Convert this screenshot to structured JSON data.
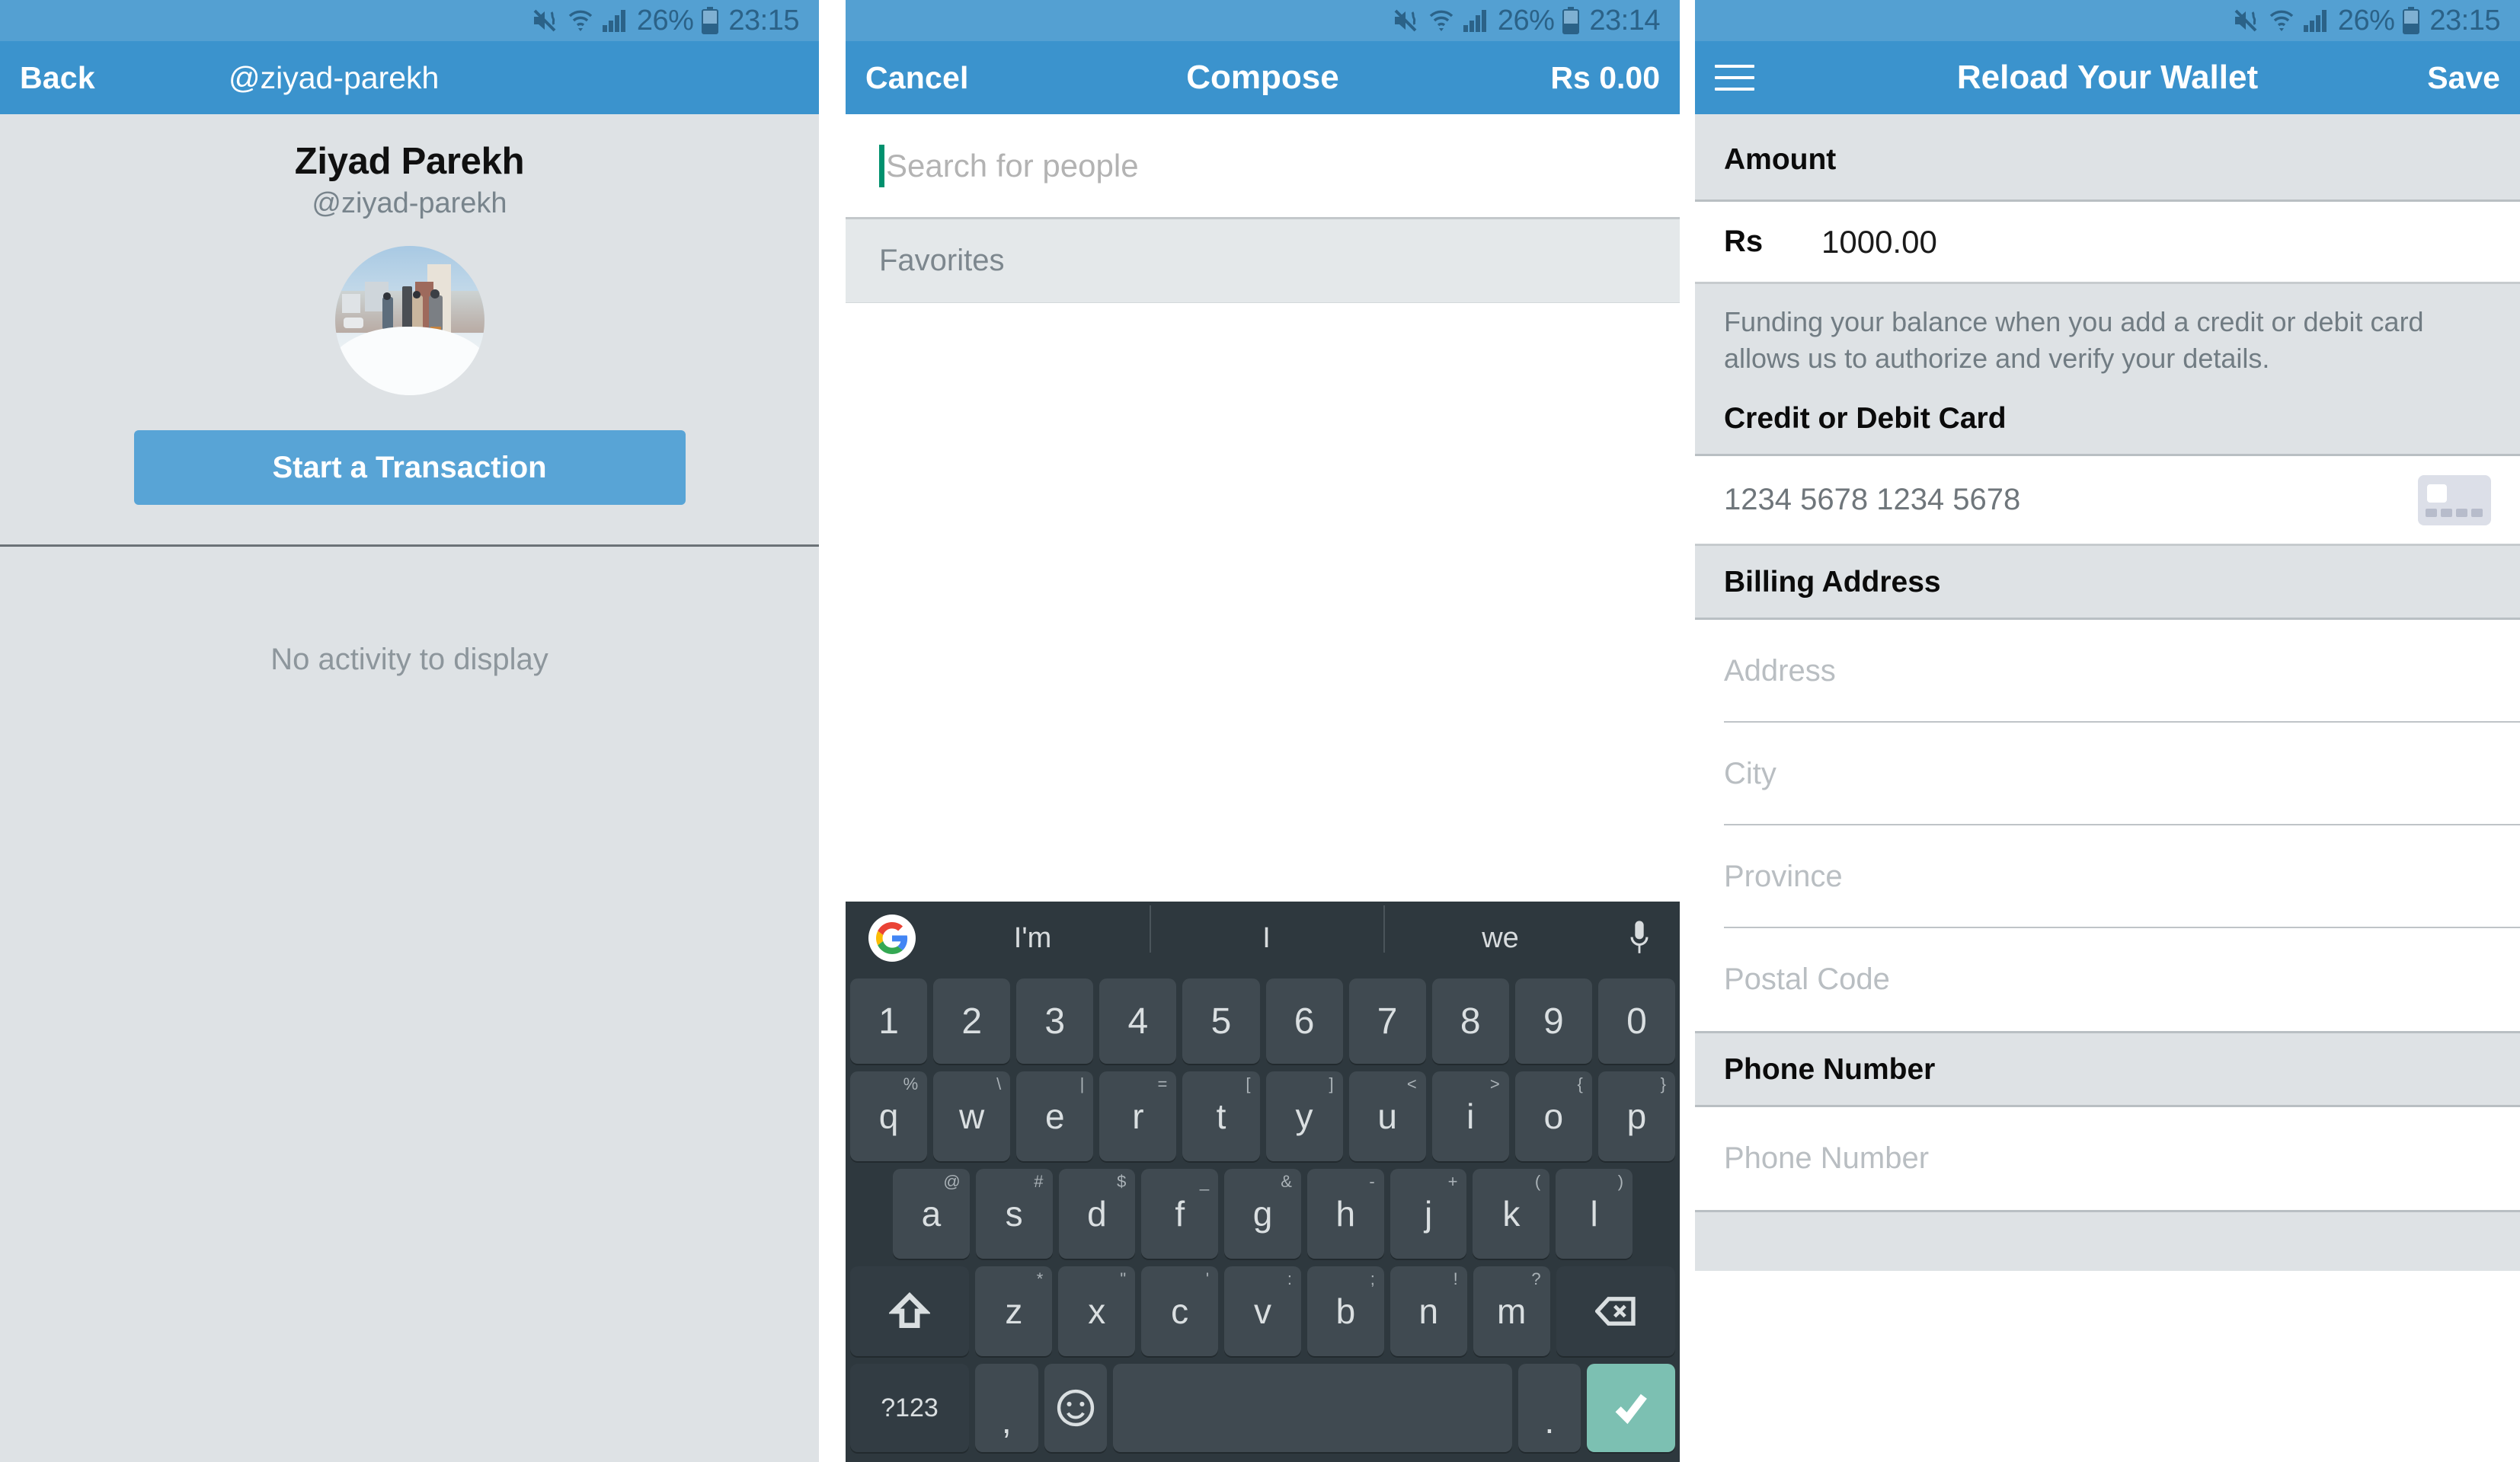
{
  "status_bar": {
    "battery_percent": "26%",
    "time_left": "23:15",
    "time_middle": "23:14",
    "time_right": "23:15",
    "icons": [
      "mute-vibrate-icon",
      "wifi-icon",
      "signal-icon",
      "battery-icon"
    ]
  },
  "profile_screen": {
    "nav": {
      "back_label": "Back",
      "title": "@ziyad-parekh"
    },
    "display_name": "Ziyad Parekh",
    "handle": "@ziyad-parekh",
    "cta_label": "Start a Transaction",
    "empty_state": "No activity to display"
  },
  "compose_screen": {
    "nav": {
      "cancel_label": "Cancel",
      "title": "Compose",
      "amount_label": "Rs 0.00"
    },
    "search_placeholder": "Search for people",
    "search_value": "",
    "section_label": "Favorites",
    "keyboard": {
      "suggestions": [
        "I'm",
        "I",
        "we"
      ],
      "google_icon": "google-logo-icon",
      "mic_icon": "microphone-icon",
      "row_numbers": [
        "1",
        "2",
        "3",
        "4",
        "5",
        "6",
        "7",
        "8",
        "9",
        "0"
      ],
      "row_q": [
        {
          "key": "q",
          "sup": "%"
        },
        {
          "key": "w",
          "sup": "\\"
        },
        {
          "key": "e",
          "sup": "|"
        },
        {
          "key": "r",
          "sup": "="
        },
        {
          "key": "t",
          "sup": "["
        },
        {
          "key": "y",
          "sup": "]"
        },
        {
          "key": "u",
          "sup": "<"
        },
        {
          "key": "i",
          "sup": ">"
        },
        {
          "key": "o",
          "sup": "{"
        },
        {
          "key": "p",
          "sup": "}"
        }
      ],
      "row_a": [
        {
          "key": "a",
          "sup": "@"
        },
        {
          "key": "s",
          "sup": "#"
        },
        {
          "key": "d",
          "sup": "$"
        },
        {
          "key": "f",
          "sup": "_"
        },
        {
          "key": "g",
          "sup": "&"
        },
        {
          "key": "h",
          "sup": "-"
        },
        {
          "key": "j",
          "sup": "+"
        },
        {
          "key": "k",
          "sup": "("
        },
        {
          "key": "l",
          "sup": ")"
        }
      ],
      "row_z": [
        {
          "key": "z",
          "sup": "*"
        },
        {
          "key": "x",
          "sup": "\""
        },
        {
          "key": "c",
          "sup": "'"
        },
        {
          "key": "v",
          "sup": ":"
        },
        {
          "key": "b",
          "sup": ";"
        },
        {
          "key": "n",
          "sup": "!"
        },
        {
          "key": "m",
          "sup": "?"
        }
      ],
      "shift_label": "shift-icon",
      "backspace_label": "backspace-icon",
      "symbols_label": "?123",
      "comma_label": ",",
      "emoji_label": "emoji-icon",
      "space_label": "",
      "period_label": ".",
      "enter_label": "checkmark-icon"
    }
  },
  "wallet_screen": {
    "nav": {
      "menu_icon": "hamburger-menu-icon",
      "title": "Reload Your Wallet",
      "save_label": "Save"
    },
    "amount_section": {
      "header": "Amount",
      "currency": "Rs",
      "value": "1000.00"
    },
    "note": "Funding your balance when you add a credit or debit card allows us to authorize and verify your details.",
    "card_section": {
      "header": "Credit or Debit Card",
      "placeholder": "1234 5678 1234 5678",
      "icon": "credit-card-icon"
    },
    "billing_section": {
      "header": "Billing Address",
      "fields": [
        {
          "placeholder": "Address"
        },
        {
          "placeholder": "City"
        },
        {
          "placeholder": "Province"
        },
        {
          "placeholder": "Postal Code"
        }
      ]
    },
    "phone_section": {
      "header": "Phone Number",
      "placeholder": "Phone Number"
    }
  },
  "colors": {
    "status_bar": "#54a0d2",
    "nav_bar": "#3b93cd",
    "accent": "#58a4d6",
    "page_bg": "#dee2e5",
    "keyboard_bg": "#2e383e",
    "key_bg": "#404a51",
    "enter_key": "#7cc0b2",
    "caret": "#00916e"
  }
}
